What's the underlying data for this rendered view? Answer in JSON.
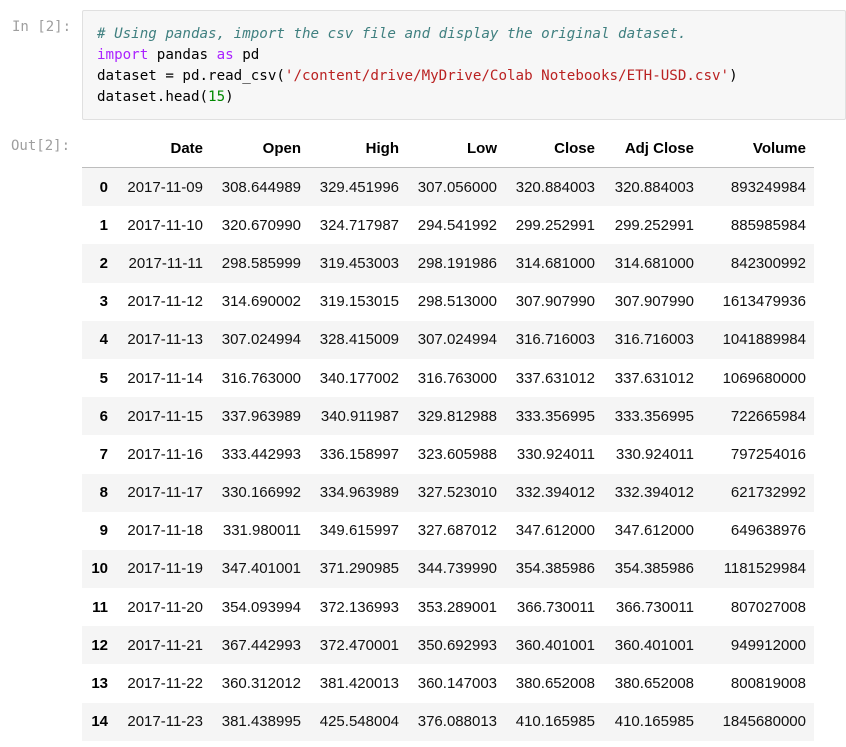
{
  "input_prompt": "In [2]:",
  "output_prompt": "Out[2]:",
  "code": {
    "comment": "# Using pandas, import the csv file and display the original dataset.",
    "line2_kw1": "import",
    "line2_mid": " pandas ",
    "line2_kw2": "as",
    "line2_end": " pd",
    "line3_start": "dataset = pd.read_csv(",
    "line3_str": "'/content/drive/MyDrive/Colab Notebooks/ETH-USD.csv'",
    "line3_end": ")",
    "line4_start": "dataset.head(",
    "line4_num": "15",
    "line4_end": ")"
  },
  "table": {
    "columns": [
      "",
      "Date",
      "Open",
      "High",
      "Low",
      "Close",
      "Adj Close",
      "Volume"
    ],
    "rows": [
      [
        "0",
        "2017-11-09",
        "308.644989",
        "329.451996",
        "307.056000",
        "320.884003",
        "320.884003",
        "893249984"
      ],
      [
        "1",
        "2017-11-10",
        "320.670990",
        "324.717987",
        "294.541992",
        "299.252991",
        "299.252991",
        "885985984"
      ],
      [
        "2",
        "2017-11-11",
        "298.585999",
        "319.453003",
        "298.191986",
        "314.681000",
        "314.681000",
        "842300992"
      ],
      [
        "3",
        "2017-11-12",
        "314.690002",
        "319.153015",
        "298.513000",
        "307.907990",
        "307.907990",
        "1613479936"
      ],
      [
        "4",
        "2017-11-13",
        "307.024994",
        "328.415009",
        "307.024994",
        "316.716003",
        "316.716003",
        "1041889984"
      ],
      [
        "5",
        "2017-11-14",
        "316.763000",
        "340.177002",
        "316.763000",
        "337.631012",
        "337.631012",
        "1069680000"
      ],
      [
        "6",
        "2017-11-15",
        "337.963989",
        "340.911987",
        "329.812988",
        "333.356995",
        "333.356995",
        "722665984"
      ],
      [
        "7",
        "2017-11-16",
        "333.442993",
        "336.158997",
        "323.605988",
        "330.924011",
        "330.924011",
        "797254016"
      ],
      [
        "8",
        "2017-11-17",
        "330.166992",
        "334.963989",
        "327.523010",
        "332.394012",
        "332.394012",
        "621732992"
      ],
      [
        "9",
        "2017-11-18",
        "331.980011",
        "349.615997",
        "327.687012",
        "347.612000",
        "347.612000",
        "649638976"
      ],
      [
        "10",
        "2017-11-19",
        "347.401001",
        "371.290985",
        "344.739990",
        "354.385986",
        "354.385986",
        "1181529984"
      ],
      [
        "11",
        "2017-11-20",
        "354.093994",
        "372.136993",
        "353.289001",
        "366.730011",
        "366.730011",
        "807027008"
      ],
      [
        "12",
        "2017-11-21",
        "367.442993",
        "372.470001",
        "350.692993",
        "360.401001",
        "360.401001",
        "949912000"
      ],
      [
        "13",
        "2017-11-22",
        "360.312012",
        "381.420013",
        "360.147003",
        "380.652008",
        "380.652008",
        "800819008"
      ],
      [
        "14",
        "2017-11-23",
        "381.438995",
        "425.548004",
        "376.088013",
        "410.165985",
        "410.165985",
        "1845680000"
      ]
    ]
  }
}
